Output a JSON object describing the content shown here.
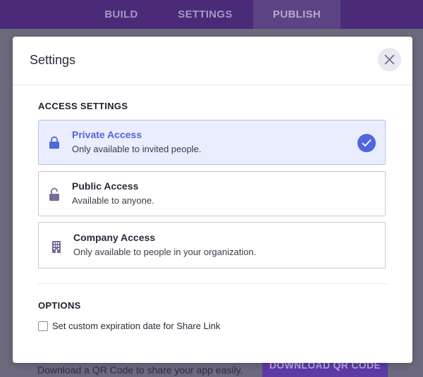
{
  "nav": {
    "tabs": [
      {
        "label": "BUILD"
      },
      {
        "label": "SETTINGS"
      },
      {
        "label": "PUBLISH",
        "active": true
      }
    ]
  },
  "background": {
    "qr_text": "Download a QR Code to share your app easily.",
    "qr_button": "DOWNLOAD QR CODE"
  },
  "modal": {
    "title": "Settings",
    "close_icon": "close-icon",
    "access_section_title": "ACCESS SETTINGS",
    "access_options": [
      {
        "label": "Private Access",
        "description": "Only available to invited people.",
        "icon": "lock-icon",
        "selected": true
      },
      {
        "label": "Public Access",
        "description": "Available to anyone.",
        "icon": "unlock-icon",
        "selected": false
      },
      {
        "label": "Company Access",
        "description": "Only available to people in your organization.",
        "icon": "building-icon",
        "selected": false
      }
    ],
    "options_section_title": "OPTIONS",
    "expiration_checkbox": {
      "label": "Set custom expiration date for Share Link",
      "checked": false
    }
  },
  "colors": {
    "accent": "#4f66dd",
    "nav_bg": "#4a2a79",
    "selected_bg": "#e9edfd",
    "icon_purple": "#7b6b98"
  }
}
